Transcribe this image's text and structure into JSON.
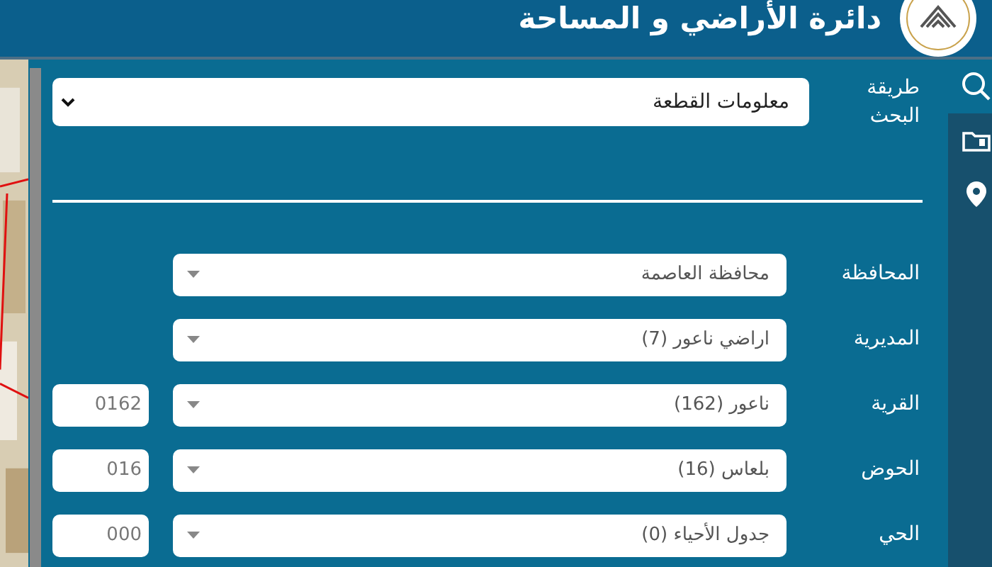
{
  "header": {
    "title": "دائرة الأراضي و المساحة"
  },
  "side_rail": [
    {
      "kind": "search",
      "selected": true
    },
    {
      "kind": "folder",
      "selected": false
    },
    {
      "kind": "pin",
      "selected": false
    }
  ],
  "search_method": {
    "label": "طريقة البحث",
    "value": "معلومات القطعة"
  },
  "fields": [
    {
      "label": "المحافظة",
      "value": "محافظة العاصمة"
    },
    {
      "label": "المديرية",
      "value": "اراضي ناعور (7)"
    },
    {
      "label": "القرية",
      "value": "ناعور (162)",
      "code": "0162"
    },
    {
      "label": "الحوض",
      "value": "بلعاس (16)",
      "code": "016"
    },
    {
      "label": "الحي",
      "value": "جدول الأحياء (0)",
      "code": "000"
    }
  ]
}
